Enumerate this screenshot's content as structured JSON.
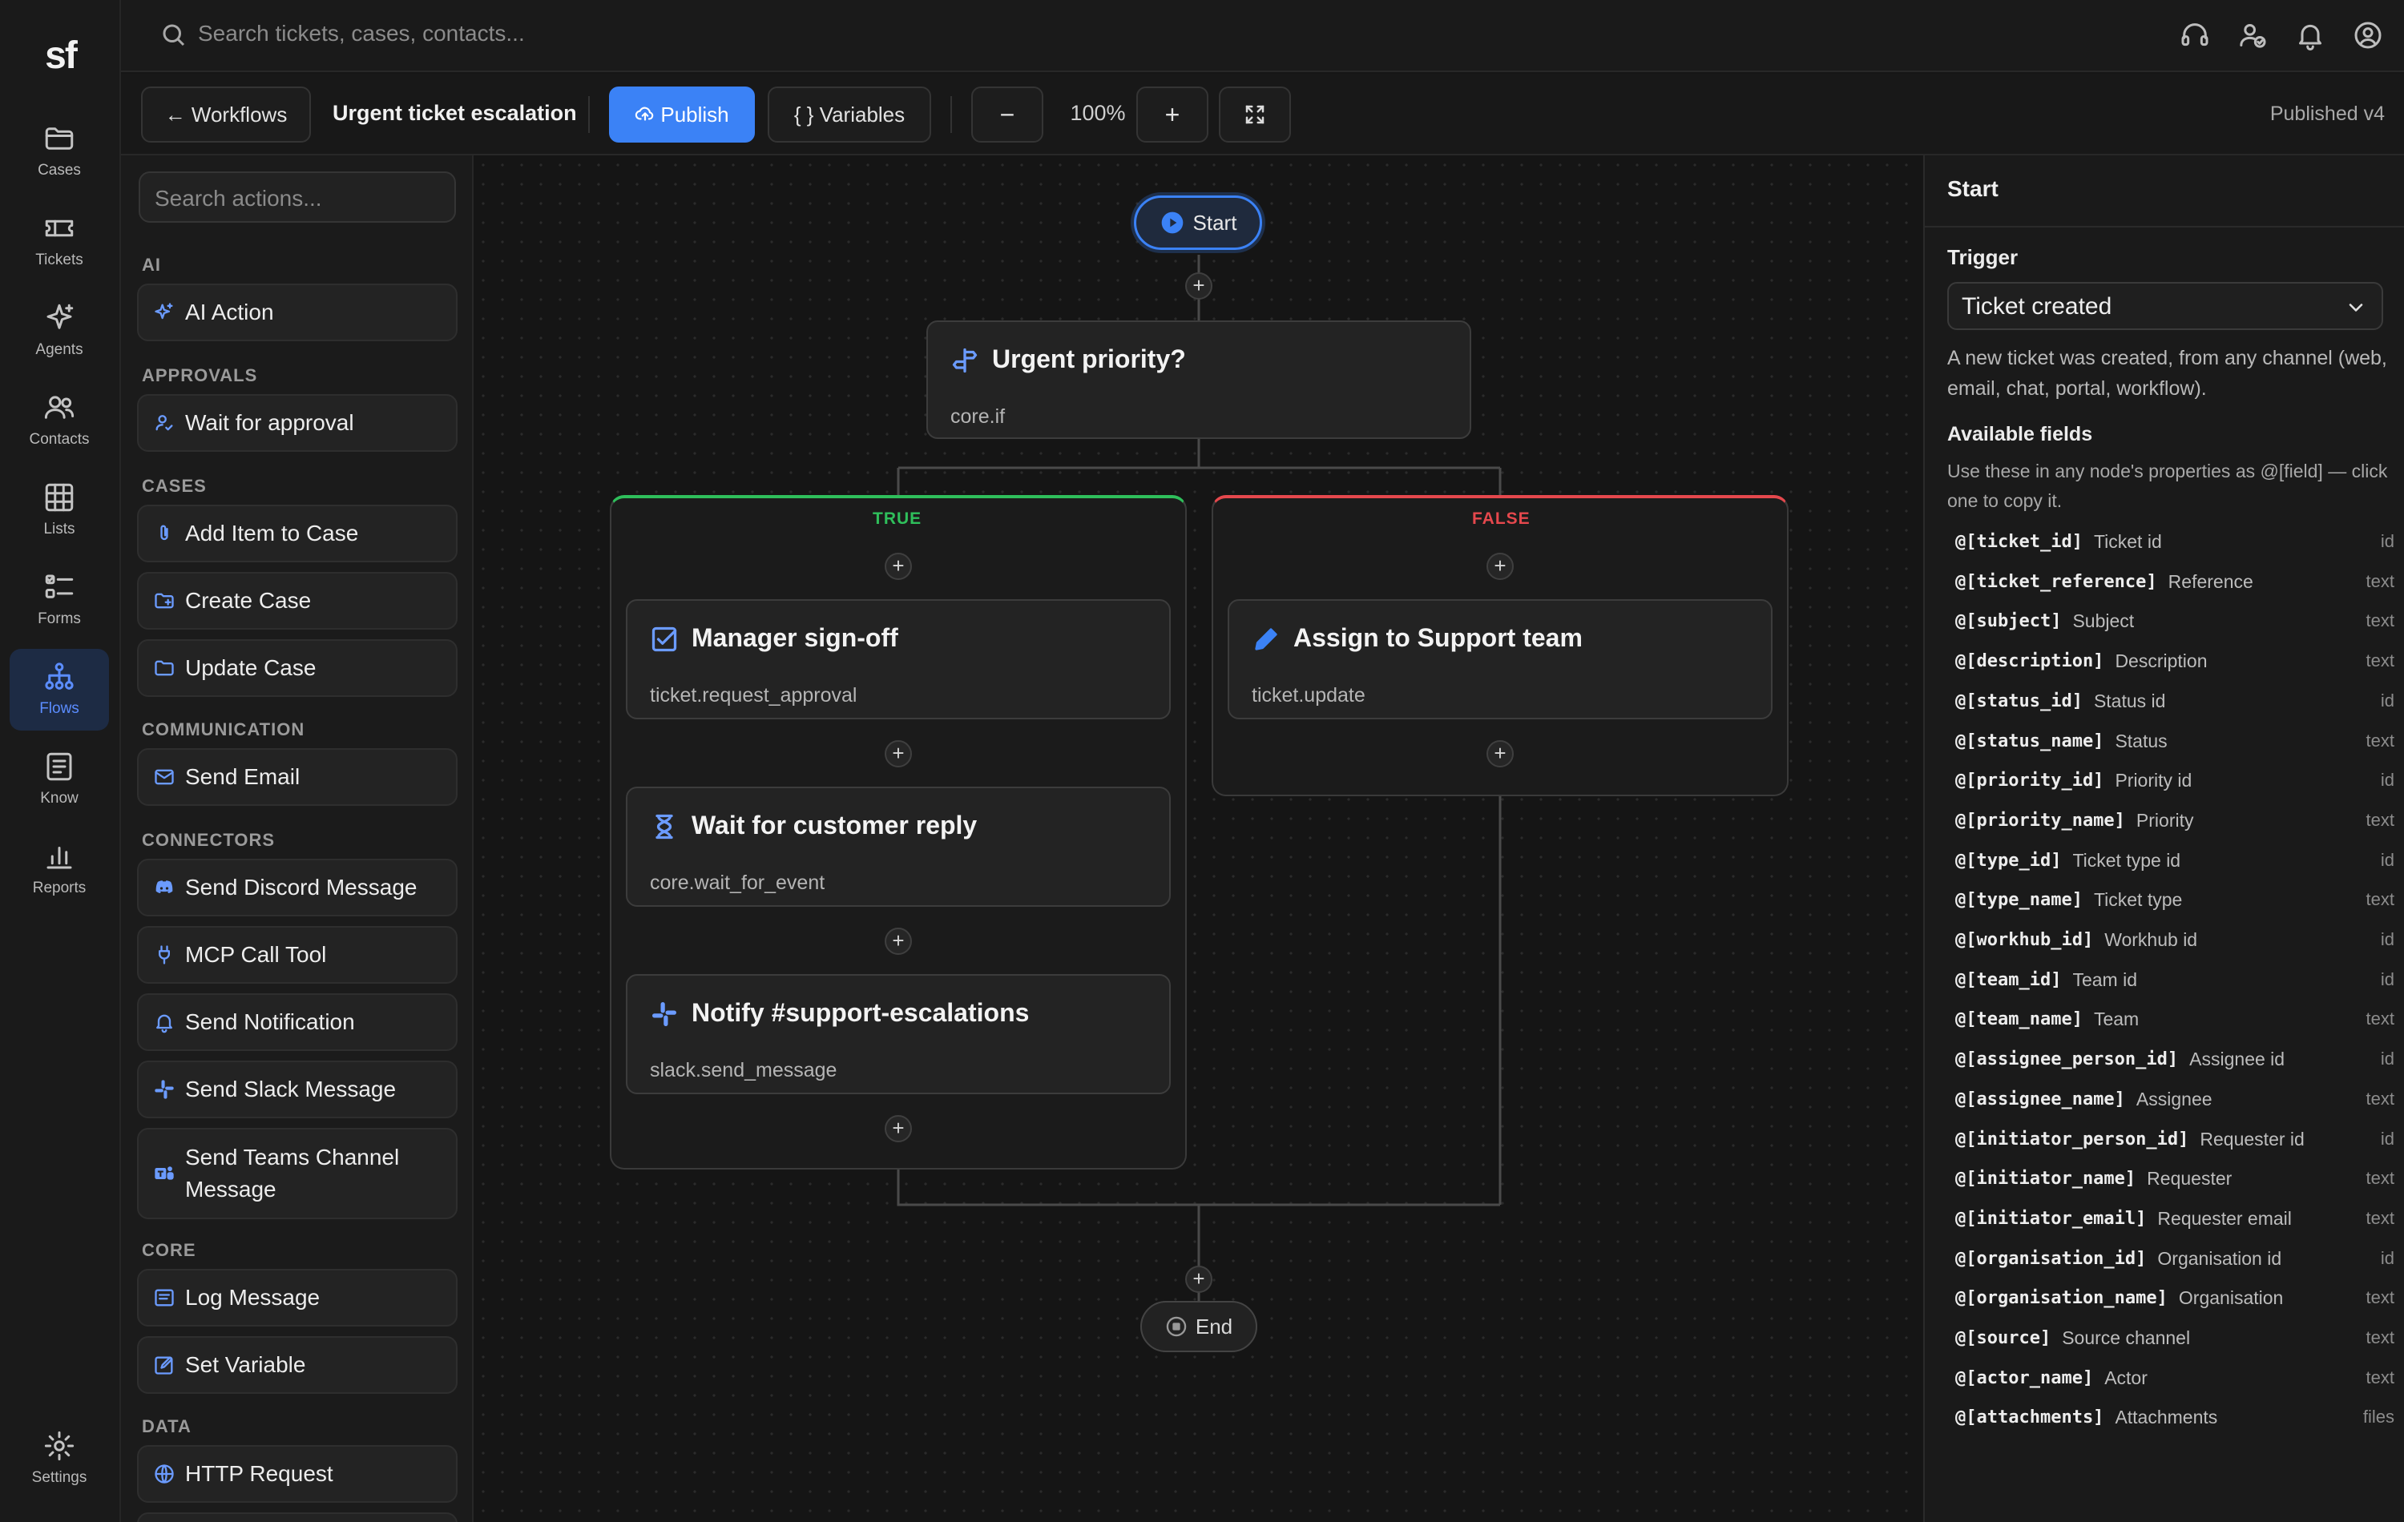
{
  "app": {
    "logo": "sf"
  },
  "nav": {
    "items": [
      {
        "label": "Cases",
        "icon": "folder-icon"
      },
      {
        "label": "Tickets",
        "icon": "ticket-icon"
      },
      {
        "label": "Agents",
        "icon": "sparkle-icon"
      },
      {
        "label": "Contacts",
        "icon": "users-icon"
      },
      {
        "label": "Lists",
        "icon": "grid-icon"
      },
      {
        "label": "Forms",
        "icon": "checklist-icon"
      },
      {
        "label": "Flows",
        "icon": "flow-icon",
        "active": true
      },
      {
        "label": "Know",
        "icon": "book-icon"
      },
      {
        "label": "Reports",
        "icon": "bar-chart-icon"
      }
    ],
    "settings": "Settings"
  },
  "topbar": {
    "search_placeholder": "Search tickets, cases, contacts..."
  },
  "toolbar": {
    "back": "← Workflows",
    "title": "Urgent ticket escalation",
    "publish": "Publish",
    "variables": "{ } Variables",
    "zoom_out": "−",
    "zoom": "100%",
    "zoom_in": "+",
    "status": "Published v4"
  },
  "palette": {
    "search_placeholder": "Search actions...",
    "sections": [
      {
        "title": "AI",
        "items": [
          "AI Action"
        ]
      },
      {
        "title": "APPROVALS",
        "items": [
          "Wait for approval"
        ]
      },
      {
        "title": "CASES",
        "items": [
          "Add Item to Case",
          "Create Case",
          "Update Case"
        ]
      },
      {
        "title": "COMMUNICATION",
        "items": [
          "Send Email"
        ]
      },
      {
        "title": "CONNECTORS",
        "items": [
          "Send Discord Message",
          "MCP Call Tool",
          "Send Notification",
          "Send Slack Message",
          "Send Teams Channel Message"
        ]
      },
      {
        "title": "CORE",
        "items": [
          "Log Message",
          "Set Variable"
        ]
      },
      {
        "title": "DATA",
        "items": [
          "HTTP Request"
        ]
      }
    ]
  },
  "flow": {
    "start": "Start",
    "end": "End",
    "condition": {
      "title": "Urgent priority?",
      "subtitle": "core.if"
    },
    "true_label": "TRUE",
    "false_label": "FALSE",
    "true_nodes": [
      {
        "title": "Manager sign-off",
        "subtitle": "ticket.request_approval",
        "icon": "checkbox-icon"
      },
      {
        "title": "Wait for customer reply",
        "subtitle": "core.wait_for_event",
        "icon": "hourglass-icon"
      },
      {
        "title": "Notify #support-escalations",
        "subtitle": "slack.send_message",
        "icon": "slack-icon"
      }
    ],
    "false_nodes": [
      {
        "title": "Assign to Support team",
        "subtitle": "ticket.update",
        "icon": "pencil-icon"
      }
    ],
    "colors": {
      "true": "#2fbf5b",
      "false": "#e5484d",
      "accent": "#3b82f6"
    }
  },
  "inspector": {
    "title": "Start",
    "trigger_label": "Trigger",
    "trigger_value": "Ticket created",
    "trigger_desc": "A new ticket was created, from any channel (web, email, chat, portal, workflow).",
    "fields_title": "Available fields",
    "fields_desc": "Use these in any node's properties as @[field] — click one to copy it.",
    "fields": [
      {
        "key": "@[ticket_id]",
        "label": "Ticket id",
        "type": "id"
      },
      {
        "key": "@[ticket_reference]",
        "label": "Reference",
        "type": "text"
      },
      {
        "key": "@[subject]",
        "label": "Subject",
        "type": "text"
      },
      {
        "key": "@[description]",
        "label": "Description",
        "type": "text"
      },
      {
        "key": "@[status_id]",
        "label": "Status id",
        "type": "id"
      },
      {
        "key": "@[status_name]",
        "label": "Status",
        "type": "text"
      },
      {
        "key": "@[priority_id]",
        "label": "Priority id",
        "type": "id"
      },
      {
        "key": "@[priority_name]",
        "label": "Priority",
        "type": "text"
      },
      {
        "key": "@[type_id]",
        "label": "Ticket type id",
        "type": "id"
      },
      {
        "key": "@[type_name]",
        "label": "Ticket type",
        "type": "text"
      },
      {
        "key": "@[workhub_id]",
        "label": "Workhub id",
        "type": "id"
      },
      {
        "key": "@[team_id]",
        "label": "Team id",
        "type": "id"
      },
      {
        "key": "@[team_name]",
        "label": "Team",
        "type": "text"
      },
      {
        "key": "@[assignee_person_id]",
        "label": "Assignee id",
        "type": "id"
      },
      {
        "key": "@[assignee_name]",
        "label": "Assignee",
        "type": "text"
      },
      {
        "key": "@[initiator_person_id]",
        "label": "Requester id",
        "type": "id"
      },
      {
        "key": "@[initiator_name]",
        "label": "Requester",
        "type": "text"
      },
      {
        "key": "@[initiator_email]",
        "label": "Requester email",
        "type": "text"
      },
      {
        "key": "@[organisation_id]",
        "label": "Organisation id",
        "type": "id"
      },
      {
        "key": "@[organisation_name]",
        "label": "Organisation",
        "type": "text"
      },
      {
        "key": "@[source]",
        "label": "Source channel",
        "type": "text"
      },
      {
        "key": "@[actor_name]",
        "label": "Actor",
        "type": "text"
      },
      {
        "key": "@[attachments]",
        "label": "Attachments",
        "type": "files"
      }
    ]
  }
}
